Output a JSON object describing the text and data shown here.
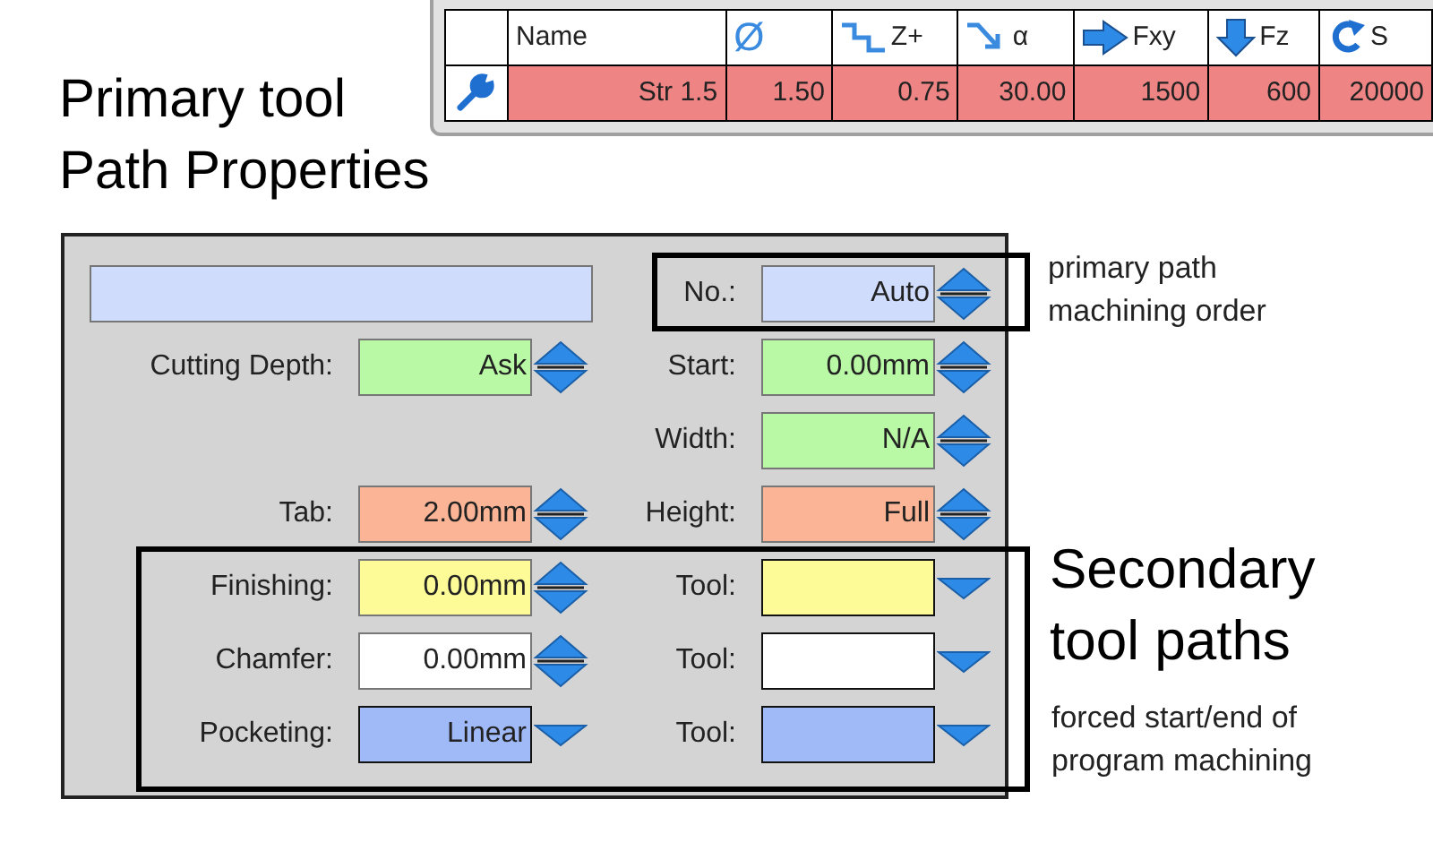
{
  "tool_table": {
    "columns": [
      {
        "kind": "tool"
      },
      {
        "kind": "plain",
        "label": "Name"
      },
      {
        "kind": "diameter",
        "label": "Ø"
      },
      {
        "kind": "step",
        "label": "Z+"
      },
      {
        "kind": "plunge",
        "label": "α"
      },
      {
        "kind": "feed_xy",
        "label": "Fxy"
      },
      {
        "kind": "feed_z",
        "label": "Fz"
      },
      {
        "kind": "speed",
        "label": "S"
      }
    ],
    "rows": [
      {
        "color": "#ee8484",
        "cells": [
          null,
          "Str 1.5",
          "1.50",
          "0.75",
          "30.00",
          "1500",
          "600",
          "20000"
        ]
      }
    ]
  },
  "heading": [
    "Primary tool",
    "Path Properties"
  ],
  "panel": {
    "name_field": {
      "color": "#d0dcfc"
    },
    "rows": [
      {
        "right": {
          "label": "No.:",
          "value": "Auto",
          "color": "#d0dcfc",
          "kind": "spin"
        }
      },
      {
        "left": {
          "label": "Cutting Depth:",
          "value": "Ask",
          "color": "#b9f9a6",
          "kind": "spin"
        },
        "right": {
          "label": "Start:",
          "value": "0.00mm",
          "color": "#b9f9a6",
          "kind": "spin"
        }
      },
      {
        "right": {
          "label": "Width:",
          "value": "N/A",
          "color": "#b9f9a6",
          "kind": "spin"
        }
      },
      {
        "left": {
          "label": "Tab:",
          "value": "2.00mm",
          "color": "#fbb596",
          "kind": "spin"
        },
        "right": {
          "label": "Height:",
          "value": "Full",
          "color": "#fbb596",
          "kind": "spin"
        }
      }
    ],
    "secondary_rows": [
      {
        "left": {
          "label": "Finishing:",
          "value": "0.00mm",
          "color": "#fdfa98",
          "kind": "spin"
        },
        "right": {
          "label": "Tool:",
          "color": "#fdfa98",
          "kind": "dropdown"
        }
      },
      {
        "left": {
          "label": "Chamfer:",
          "value": "0.00mm",
          "color": "#ffffff",
          "kind": "spin"
        },
        "right": {
          "label": "Tool:",
          "color": "#ffffff",
          "kind": "dropdown"
        }
      },
      {
        "left": {
          "label": "Pocketing:",
          "value": "Linear",
          "color": "#a0baf8",
          "kind": "dropdown"
        },
        "right": {
          "label": "Tool:",
          "color": "#a0baf8",
          "kind": "dropdown"
        }
      }
    ]
  },
  "notes": {
    "primary": [
      "primary path",
      "machining order"
    ],
    "secondary_title": [
      "Secondary",
      "tool paths"
    ],
    "secondary": [
      "forced start/end of",
      "program machining"
    ]
  }
}
